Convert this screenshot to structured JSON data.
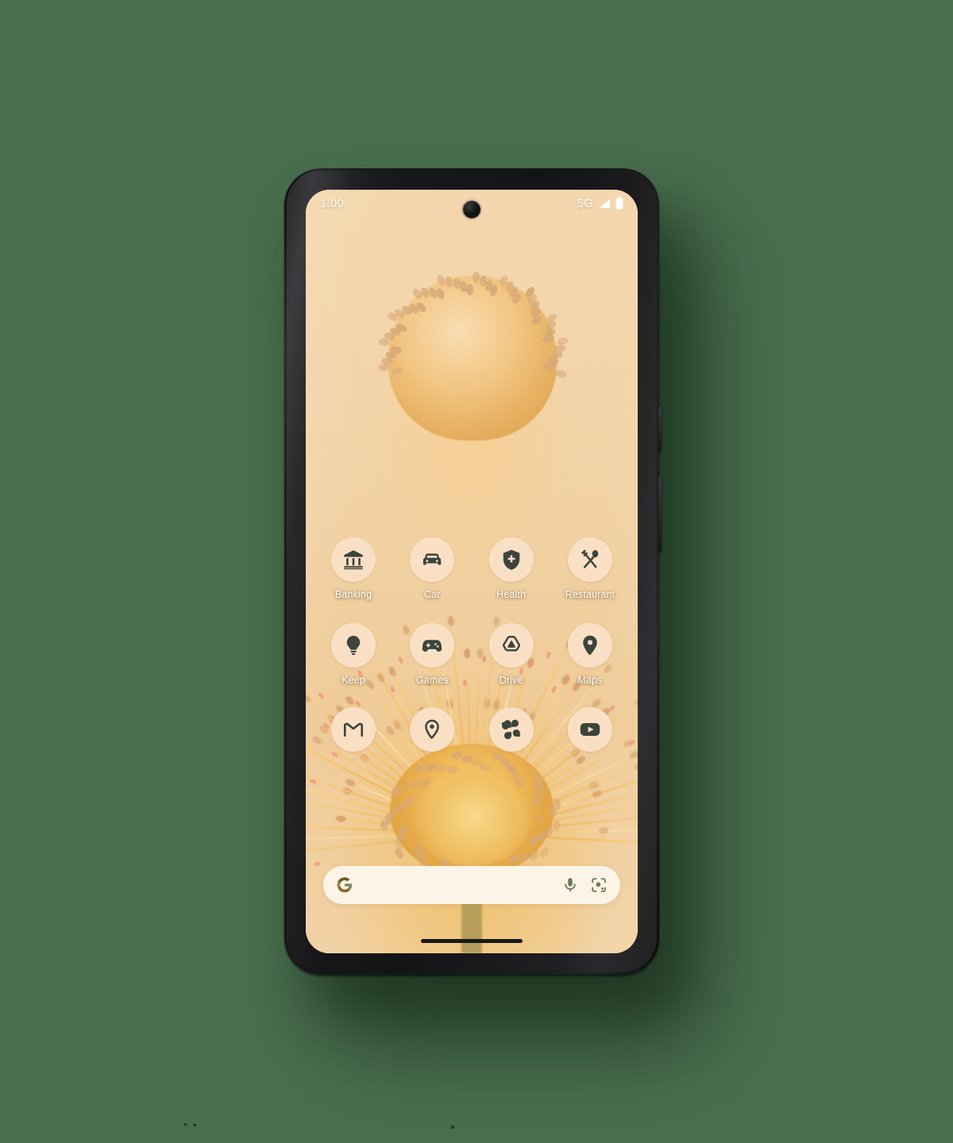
{
  "page": {
    "background_color": "#4a6f4e",
    "device": "pixel-phone-home-screen"
  },
  "status_bar": {
    "time": "1:00",
    "network": "5G",
    "signal_icon": "signal-bars-icon",
    "battery_icon": "battery-full-icon",
    "camera": "front-camera-punch-hole",
    "text_color": "#ffffff"
  },
  "wallpaper": {
    "name": "pincushion-protea-flower",
    "base_color": "#f2d5ab",
    "accent_color": "#eeb35c"
  },
  "theme": {
    "icon_background": "#f9e0c5",
    "icon_foreground": "#3c443c",
    "search_background": "#fbf4e7",
    "label_color": "#ffffff"
  },
  "app_grid": {
    "rows": [
      {
        "apps": [
          {
            "label": "Banking",
            "icon": "bank-icon"
          },
          {
            "label": "Car",
            "icon": "car-icon"
          },
          {
            "label": "Health",
            "icon": "shield-plus-icon"
          },
          {
            "label": "Restaurant",
            "icon": "fork-spoon-icon"
          }
        ]
      },
      {
        "apps": [
          {
            "label": "Keep",
            "icon": "lightbulb-icon"
          },
          {
            "label": "Games",
            "icon": "gamepad-icon"
          },
          {
            "label": "Drive",
            "icon": "drive-triangle-icon"
          },
          {
            "label": "Maps",
            "icon": "map-pin-icon"
          }
        ]
      }
    ],
    "dock": {
      "apps": [
        {
          "label": "",
          "icon": "gmail-icon"
        },
        {
          "label": "",
          "icon": "map-pin-icon"
        },
        {
          "label": "",
          "icon": "photos-pinwheel-icon"
        },
        {
          "label": "",
          "icon": "youtube-icon"
        }
      ]
    }
  },
  "search": {
    "placeholder": "",
    "value": "",
    "google_icon": "google-g-icon",
    "mic_icon": "microphone-icon",
    "lens_icon": "google-lens-icon",
    "g_color_primary": "#8a6a1e",
    "g_color_secondary": "#7b8a63"
  },
  "navigation": {
    "gesture_bar": "home-gesture-pill"
  },
  "hardware": {
    "power_button": "power-button",
    "volume_button": "volume-rocker"
  }
}
